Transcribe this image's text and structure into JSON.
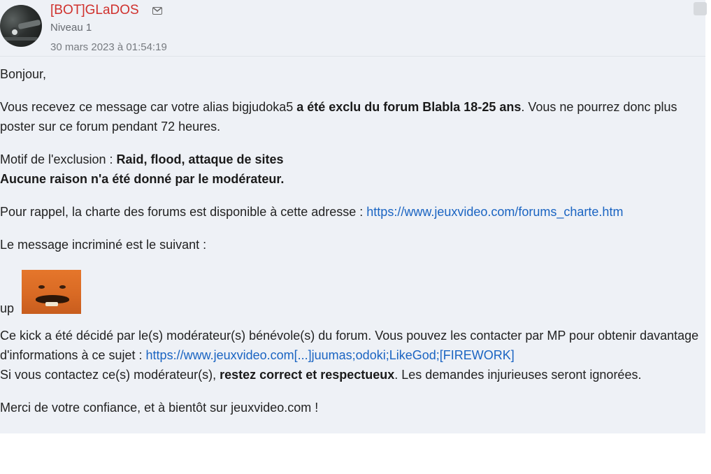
{
  "post": {
    "author": "[BOT]GLaDOS",
    "level": "Niveau 1",
    "date": "30 mars 2023 à 01:54:19",
    "icons": {
      "avatar": "glados-avatar",
      "mail": "mail-icon",
      "report": "report-icon"
    }
  },
  "message": {
    "greeting": "Bonjour,",
    "p1": {
      "t1": "Vous recevez ce message car votre alias bigjudoka5 ",
      "b1": "a été exclu du forum Blabla 18-25 ans",
      "t2": ". Vous ne pourrez donc plus poster sur ce forum pendant 72 heures."
    },
    "p2": {
      "t1": "Motif de l'exclusion : ",
      "b1": "Raid, flood, attaque de sites",
      "b2": "Aucune raison n'a été donné par le modérateur."
    },
    "p3": {
      "t1": "Pour rappel, la charte des forums est disponible à cette adresse : ",
      "link": "https://www.jeuxvideo.com/forums_charte.htm"
    },
    "p4": "Le message incriminé est le suivant :",
    "quoted": {
      "text": "up",
      "sticker": "risitas-sticker"
    },
    "p5": {
      "t1": "Ce kick a été décidé par le(s) modérateur(s) bénévole(s) du forum. Vous pouvez les contacter par MP pour obtenir davantage d'informations à ce sujet : ",
      "link": "https://www.jeuxvideo.com[...]juumas;odoki;LikeGod;[FIREWORK]",
      "t2": "Si vous contactez ce(s) modérateur(s), ",
      "b1": "restez correct et respectueux",
      "t3": ". Les demandes injurieuses seront ignorées."
    },
    "closing": "Merci de votre confiance, et à bientôt sur jeuxvideo.com !"
  },
  "colors": {
    "author": "#d0312d",
    "link": "#1a64c2",
    "background": "#eef1f6"
  }
}
